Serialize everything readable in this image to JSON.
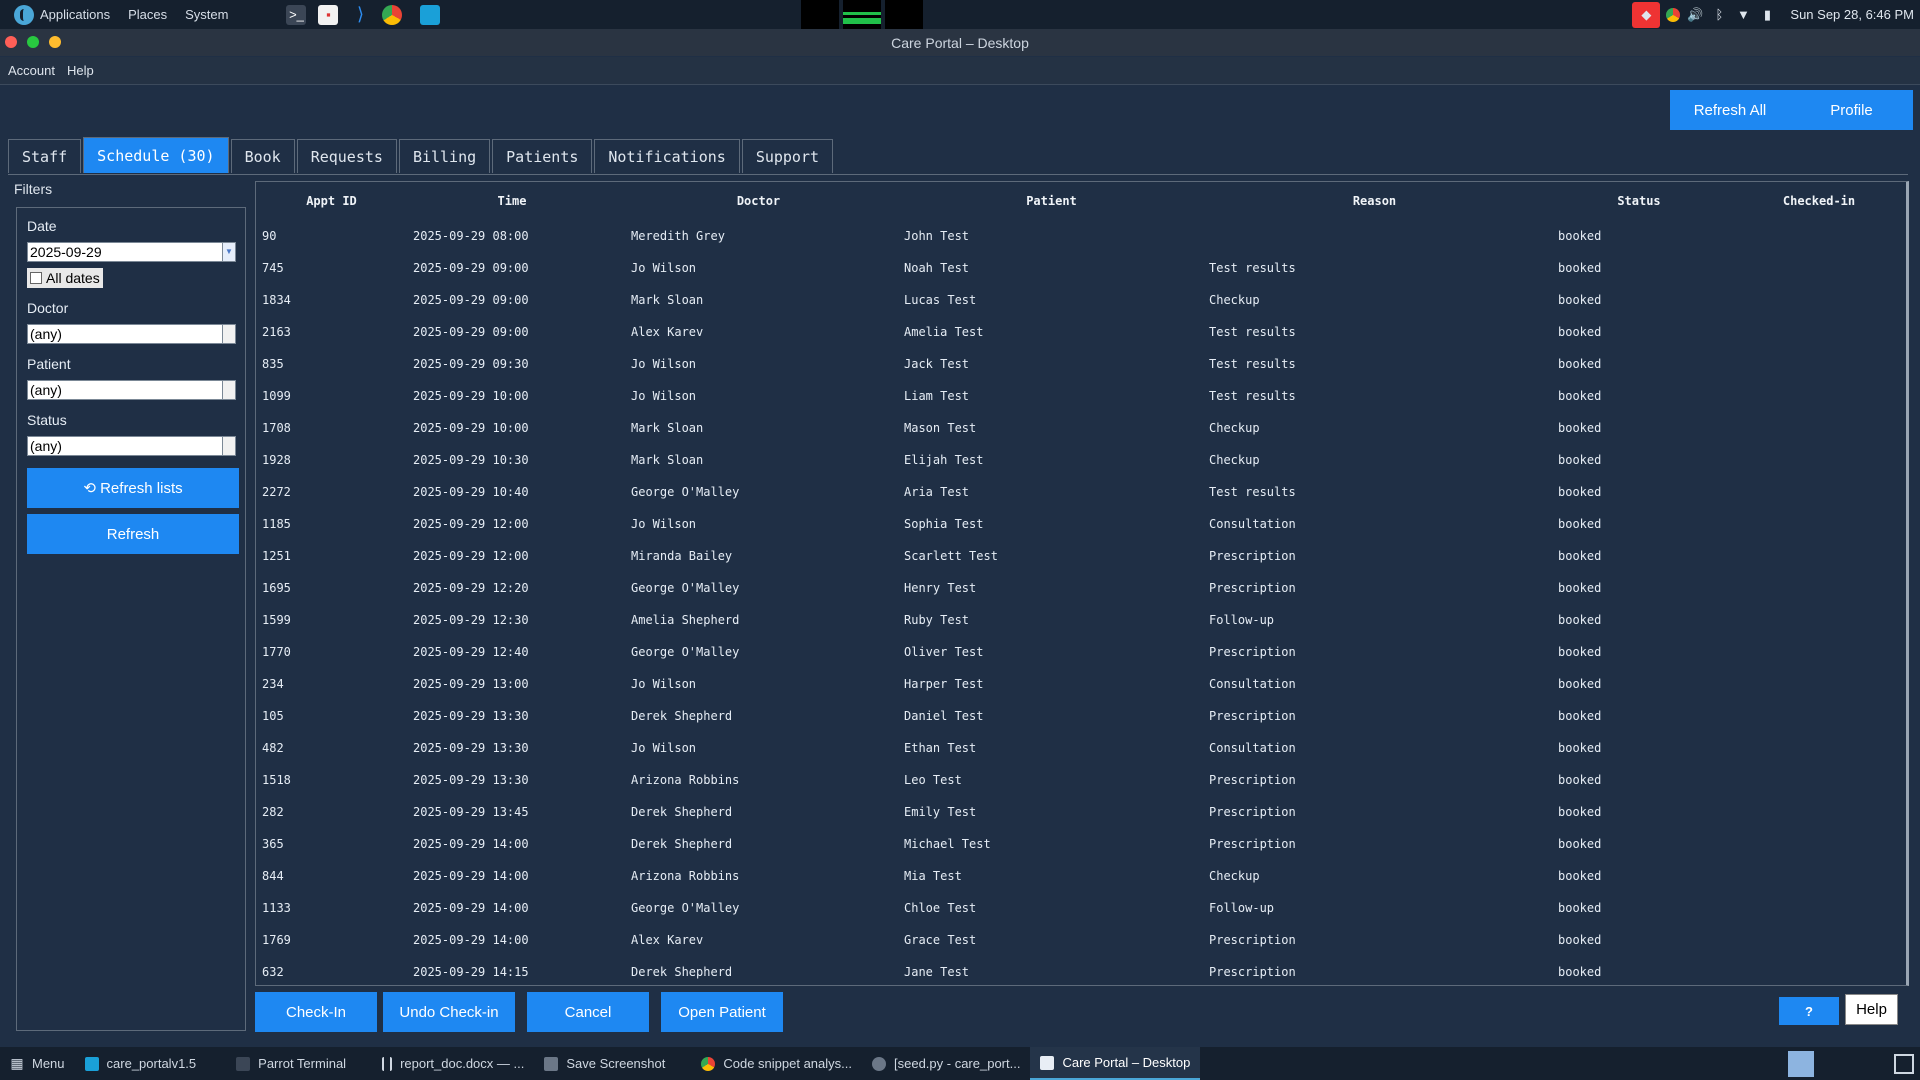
{
  "system_bar": {
    "menus": [
      "Applications",
      "Places",
      "System"
    ],
    "clock": "Sun Sep 28,  6:46 PM",
    "launchers": [
      "terminal-icon",
      "document-viewer-icon",
      "vscode-icon",
      "chrome-icon",
      "files-icon"
    ]
  },
  "window": {
    "title": "Care Portal – Desktop"
  },
  "menubar": {
    "items": [
      "Account",
      "Help"
    ]
  },
  "top_buttons": {
    "refresh_all": "Refresh All",
    "profile": "Profile"
  },
  "tabs": [
    {
      "label": "Staff",
      "active": false
    },
    {
      "label": "Schedule (30)",
      "active": true
    },
    {
      "label": "Book",
      "active": false
    },
    {
      "label": "Requests",
      "active": false
    },
    {
      "label": "Billing",
      "active": false
    },
    {
      "label": "Patients",
      "active": false
    },
    {
      "label": "Notifications",
      "active": false
    },
    {
      "label": "Support",
      "active": false
    }
  ],
  "filters": {
    "title": "Filters",
    "date_label": "Date",
    "date_value": "2025-09-29",
    "all_dates_label": "All dates",
    "doctor_label": "Doctor",
    "doctor_value": "(any)",
    "patient_label": "Patient",
    "patient_value": "(any)",
    "status_label": "Status",
    "status_value": "(any)",
    "refresh_lists": "⟲ Refresh lists",
    "refresh": "Refresh"
  },
  "table": {
    "columns": [
      "Appt ID",
      "Time",
      "Doctor",
      "Patient",
      "Reason",
      "Status",
      "Checked-in"
    ],
    "rows": [
      [
        "90",
        "2025-09-29 08:00",
        "Meredith Grey",
        "John Test",
        "",
        "booked",
        ""
      ],
      [
        "745",
        "2025-09-29 09:00",
        "Jo Wilson",
        "Noah Test",
        "Test results",
        "booked",
        ""
      ],
      [
        "1834",
        "2025-09-29 09:00",
        "Mark Sloan",
        "Lucas Test",
        "Checkup",
        "booked",
        ""
      ],
      [
        "2163",
        "2025-09-29 09:00",
        "Alex Karev",
        "Amelia Test",
        "Test results",
        "booked",
        ""
      ],
      [
        "835",
        "2025-09-29 09:30",
        "Jo Wilson",
        "Jack Test",
        "Test results",
        "booked",
        ""
      ],
      [
        "1099",
        "2025-09-29 10:00",
        "Jo Wilson",
        "Liam Test",
        "Test results",
        "booked",
        ""
      ],
      [
        "1708",
        "2025-09-29 10:00",
        "Mark Sloan",
        "Mason Test",
        "Checkup",
        "booked",
        ""
      ],
      [
        "1928",
        "2025-09-29 10:30",
        "Mark Sloan",
        "Elijah Test",
        "Checkup",
        "booked",
        ""
      ],
      [
        "2272",
        "2025-09-29 10:40",
        "George O'Malley",
        "Aria Test",
        "Test results",
        "booked",
        ""
      ],
      [
        "1185",
        "2025-09-29 12:00",
        "Jo Wilson",
        "Sophia Test",
        "Consultation",
        "booked",
        ""
      ],
      [
        "1251",
        "2025-09-29 12:00",
        "Miranda Bailey",
        "Scarlett Test",
        "Prescription",
        "booked",
        ""
      ],
      [
        "1695",
        "2025-09-29 12:20",
        "George O'Malley",
        "Henry Test",
        "Prescription",
        "booked",
        ""
      ],
      [
        "1599",
        "2025-09-29 12:30",
        "Amelia Shepherd",
        "Ruby Test",
        "Follow-up",
        "booked",
        ""
      ],
      [
        "1770",
        "2025-09-29 12:40",
        "George O'Malley",
        "Oliver Test",
        "Prescription",
        "booked",
        ""
      ],
      [
        "234",
        "2025-09-29 13:00",
        "Jo Wilson",
        "Harper Test",
        "Consultation",
        "booked",
        ""
      ],
      [
        "105",
        "2025-09-29 13:30",
        "Derek Shepherd",
        "Daniel Test",
        "Prescription",
        "booked",
        ""
      ],
      [
        "482",
        "2025-09-29 13:30",
        "Jo Wilson",
        "Ethan Test",
        "Consultation",
        "booked",
        ""
      ],
      [
        "1518",
        "2025-09-29 13:30",
        "Arizona Robbins",
        "Leo Test",
        "Prescription",
        "booked",
        ""
      ],
      [
        "282",
        "2025-09-29 13:45",
        "Derek Shepherd",
        "Emily Test",
        "Prescription",
        "booked",
        ""
      ],
      [
        "365",
        "2025-09-29 14:00",
        "Derek Shepherd",
        "Michael Test",
        "Prescription",
        "booked",
        ""
      ],
      [
        "844",
        "2025-09-29 14:00",
        "Arizona Robbins",
        "Mia Test",
        "Checkup",
        "booked",
        ""
      ],
      [
        "1133",
        "2025-09-29 14:00",
        "George O'Malley",
        "Chloe Test",
        "Follow-up",
        "booked",
        ""
      ],
      [
        "1769",
        "2025-09-29 14:00",
        "Alex Karev",
        "Grace Test",
        "Prescription",
        "booked",
        ""
      ],
      [
        "632",
        "2025-09-29 14:15",
        "Derek Shepherd",
        "Jane Test",
        "Prescription",
        "booked",
        ""
      ]
    ]
  },
  "actions": {
    "check_in": "Check-In",
    "undo_check_in": "Undo Check-in",
    "cancel": "Cancel",
    "open_patient": "Open Patient",
    "question": "?",
    "help": "Help"
  },
  "taskbar": {
    "menu": "Menu",
    "tasks": [
      {
        "label": "care_portalv1.5",
        "icon": "folder-icon",
        "active": false
      },
      {
        "label": "Parrot Terminal",
        "icon": "terminal-icon",
        "active": false
      },
      {
        "label": "report_doc.docx — ...",
        "icon": "document-icon",
        "active": false
      },
      {
        "label": "Save Screenshot",
        "icon": "screenshot-icon",
        "active": false
      },
      {
        "label": "Code snippet analys...",
        "icon": "chrome-icon",
        "active": false
      },
      {
        "label": "[seed.py - care_port...",
        "icon": "editor-icon",
        "active": false
      },
      {
        "label": "Care Portal – Desktop",
        "icon": "window-icon",
        "active": true
      }
    ]
  },
  "colors": {
    "background": "#1f2f45",
    "accent": "#1e88f2",
    "bar": "#15202e"
  }
}
